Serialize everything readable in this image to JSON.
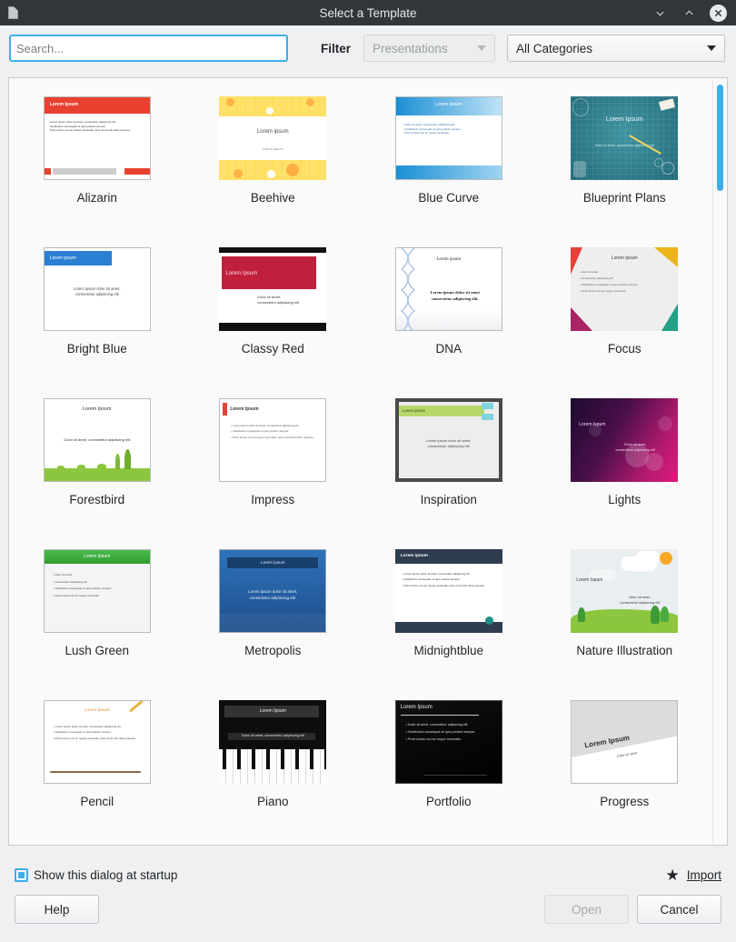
{
  "window": {
    "title": "Select a Template",
    "app_icon": "document-icon",
    "controls": {
      "minimize": "minimize-icon",
      "maximize": "maximize-icon",
      "close": "close-icon"
    }
  },
  "toolbar": {
    "search_placeholder": "Search...",
    "search_value": "",
    "filter_label": "Filter",
    "application_filter": {
      "value": "Presentations",
      "enabled": false
    },
    "category_filter": {
      "value": "All Categories",
      "enabled": true
    }
  },
  "templates": [
    {
      "name": "Alizarin",
      "title": "Lorem Ipsum",
      "body": "Lorem ipsum dolor sit amet, consectetur adipiscing elit. Vestibulum consequat mi quis pretium semper. Proin luctus orci ac neque venenatis, quis commodo dolor posuere.",
      "accent": "#e8412f"
    },
    {
      "name": "Beehive",
      "title": "Lorem ipsum",
      "body": "Lorem ipsum",
      "accent": "#ffd94a"
    },
    {
      "name": "Blue Curve",
      "title": "Lorem Ipsum",
      "body": "Dolor sit amet, consectetur adipiscing elit. Vestibulum consequat mi quis pretium semper. Proin luctus orci ac neque venenatis.",
      "accent": "#1b8fd4"
    },
    {
      "name": "Blueprint Plans",
      "title": "Lorem Ipsum",
      "body": "Dolor sit amet, consectetur adipiscing elit",
      "accent": "#2c7e8c"
    },
    {
      "name": "Bright Blue",
      "title": "Lorem ipsum",
      "body": "Lorem ipsum dolor sit amet, consectetur adipiscing elit",
      "accent": "#2b7fd4"
    },
    {
      "name": "Classy Red",
      "title": "Lorem Ipsum",
      "body": "Dolor sit amet, consectetur adipiscing elit",
      "accent": "#c0203c"
    },
    {
      "name": "DNA",
      "title": "Lorem ipsum",
      "body": "Lorem ipsum dolor sit amet consectetur adipiscing elit.",
      "accent": "#9db8d8"
    },
    {
      "name": "Focus",
      "title": "Lorem ipsum",
      "body": "dolor sit amet; consectetur adipiscing elit; Vestibulum consequat mi quis pretium semper; Proin luctus orci ac neque venenatis",
      "accent": "#e8413a"
    },
    {
      "name": "Forestbird",
      "title": "Lorem Ipsum",
      "body": "Dolor sit amet, consectetur adipiscing elit",
      "accent": "#7dc242"
    },
    {
      "name": "Impress",
      "title": "Lorem Ipsum",
      "body": "Lorem ipsum dolor sit amet, consectetur adipiscing elit. Vestibulum consequat mi quis pretium semper. Proin luctus orci ac neque venenatis, quis commodo dolor posuere.",
      "accent": "#e8413a"
    },
    {
      "name": "Inspiration",
      "title": "Lorem ipsum",
      "body": "Lorem ipsum dolor sit amet, consectetur adipiscing elit",
      "accent": "#b6d86a"
    },
    {
      "name": "Lights",
      "title": "Lorem Ispum",
      "body": "Dolor sit amet, consectetur adipiscing elit",
      "accent": "#e0197c"
    },
    {
      "name": "Lush Green",
      "title": "Lorem Ipsum",
      "body": "Dolor sit amet; Consectetur adipiscing elit; Vestibulum consequat mi quis pretium semper; Proin luctus orci ac neque venenatis",
      "accent": "#3aa93a"
    },
    {
      "name": "Metropolis",
      "title": "Lorem ipsum",
      "body": "Lorem ipsum dolor sit amet, consectetur adipiscing elit.",
      "accent": "#2a6ab0"
    },
    {
      "name": "Midnightblue",
      "title": "Lorem ipsum",
      "body": "Lorem ipsum dolor sit amet, consectetur adipiscing elit. Vestibulum consequat mi quis pretium semper. Proin luctus orci ac neque venenatis, quis commodo dolor posuere.",
      "accent": "#2e3d50"
    },
    {
      "name": "Nature Illustration",
      "title": "Lorem Ispum",
      "body": "dolor sit amet, consectetur adipiscing elit",
      "accent": "#8cc63f"
    },
    {
      "name": "Pencil",
      "title": "Lorem ipsum",
      "body": "Lorem ipsum dolor sit amet, consectetur adipiscing elit. Vestibulum consequat mi quis pretium semper. Proin luctus orci ac neque venenatis, quis commodo dolor posuere.",
      "accent": "#e8902f"
    },
    {
      "name": "Piano",
      "title": "Lorem Ipsum",
      "body": "Dolor sit amet, consectetur adipiscing elit",
      "accent": "#1a1a1a"
    },
    {
      "name": "Portfolio",
      "title": "Lorem Ipsum",
      "body": "Dolor sit amet, consectetur adipiscing elit. Vestibulum consequat mi quis pretium semper. Proin luctus orci ac neque venenatis.",
      "accent": "#0d0d0d"
    },
    {
      "name": "Progress",
      "title": "Lorem Ipsum",
      "body": "Dolor sit amet",
      "accent": "#d9d9d9"
    }
  ],
  "footer": {
    "startup_checkbox_label": "Show this dialog at startup",
    "startup_checked": true,
    "import_label": "Import",
    "import_icon": "star-icon",
    "help_label": "Help",
    "open_label": "Open",
    "open_enabled": false,
    "cancel_label": "Cancel"
  },
  "scrollbar": {
    "position": "top",
    "accent": "#3daee9"
  }
}
